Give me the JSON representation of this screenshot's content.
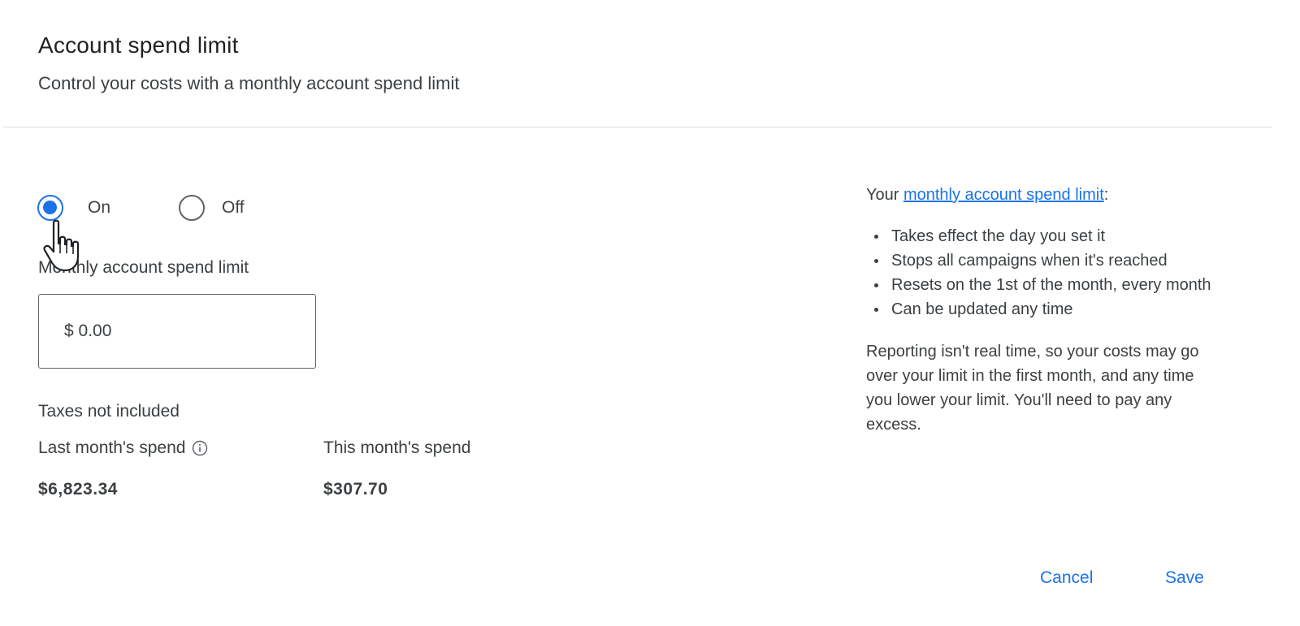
{
  "header": {
    "title": "Account spend limit",
    "subtitle": "Control your costs with a monthly account spend limit"
  },
  "toggle": {
    "on_label": "On",
    "off_label": "Off",
    "selected": "On"
  },
  "limit_field": {
    "label": "Monthly account spend limit",
    "value": "$ 0.00"
  },
  "taxes_note": "Taxes not included",
  "spend": {
    "last_month_label": "Last month's spend",
    "last_month_value": "$6,823.34",
    "this_month_label": "This month's spend",
    "this_month_value": "$307.70"
  },
  "info_panel": {
    "intro_prefix": "Your ",
    "intro_link": "monthly account spend limit",
    "intro_suffix": ":",
    "items": [
      "Takes effect the day you set it",
      "Stops all campaigns when it's reached",
      "Resets on the 1st of the month, every month",
      "Can be updated any time"
    ],
    "note": "Reporting isn't real time, so your costs may go over your limit in the first month, and any time you lower your limit. You'll need to pay any excess."
  },
  "actions": {
    "cancel_label": "Cancel",
    "save_label": "Save"
  },
  "colors": {
    "accent": "#1a73e8",
    "text": "#3c4043",
    "divider": "#dadce0"
  },
  "icons": [
    "radio-checked-icon",
    "radio-unchecked-icon",
    "hand-pointer-icon",
    "info-icon"
  ]
}
